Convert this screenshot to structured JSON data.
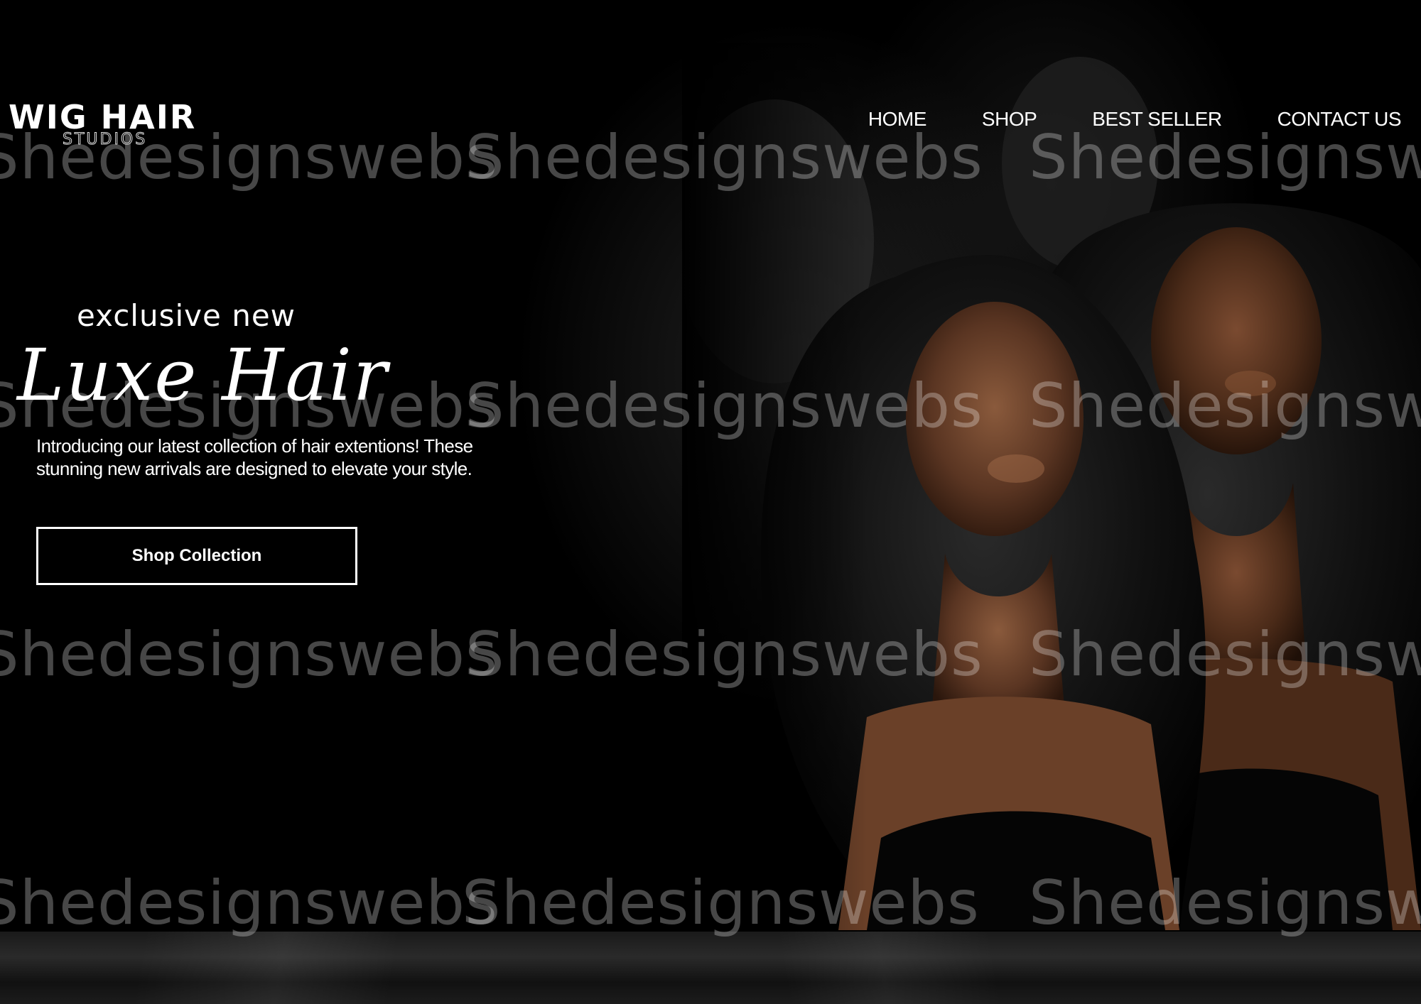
{
  "header": {
    "logo_main": "WIG HAIR",
    "logo_sub": "STUDIOS",
    "nav": [
      {
        "label": "HOME"
      },
      {
        "label": "SHOP"
      },
      {
        "label": "BEST SELLER"
      },
      {
        "label": "CONTACT US"
      }
    ]
  },
  "hero": {
    "tagline": "exclusive new",
    "headline": "Luxe Hair",
    "intro": "Introducing our latest collection of hair extentions! These stunning new arrivals are designed to elevate your style.",
    "cta_label": "Shop Collection"
  },
  "watermark": {
    "text": "Shedesignswebs"
  }
}
